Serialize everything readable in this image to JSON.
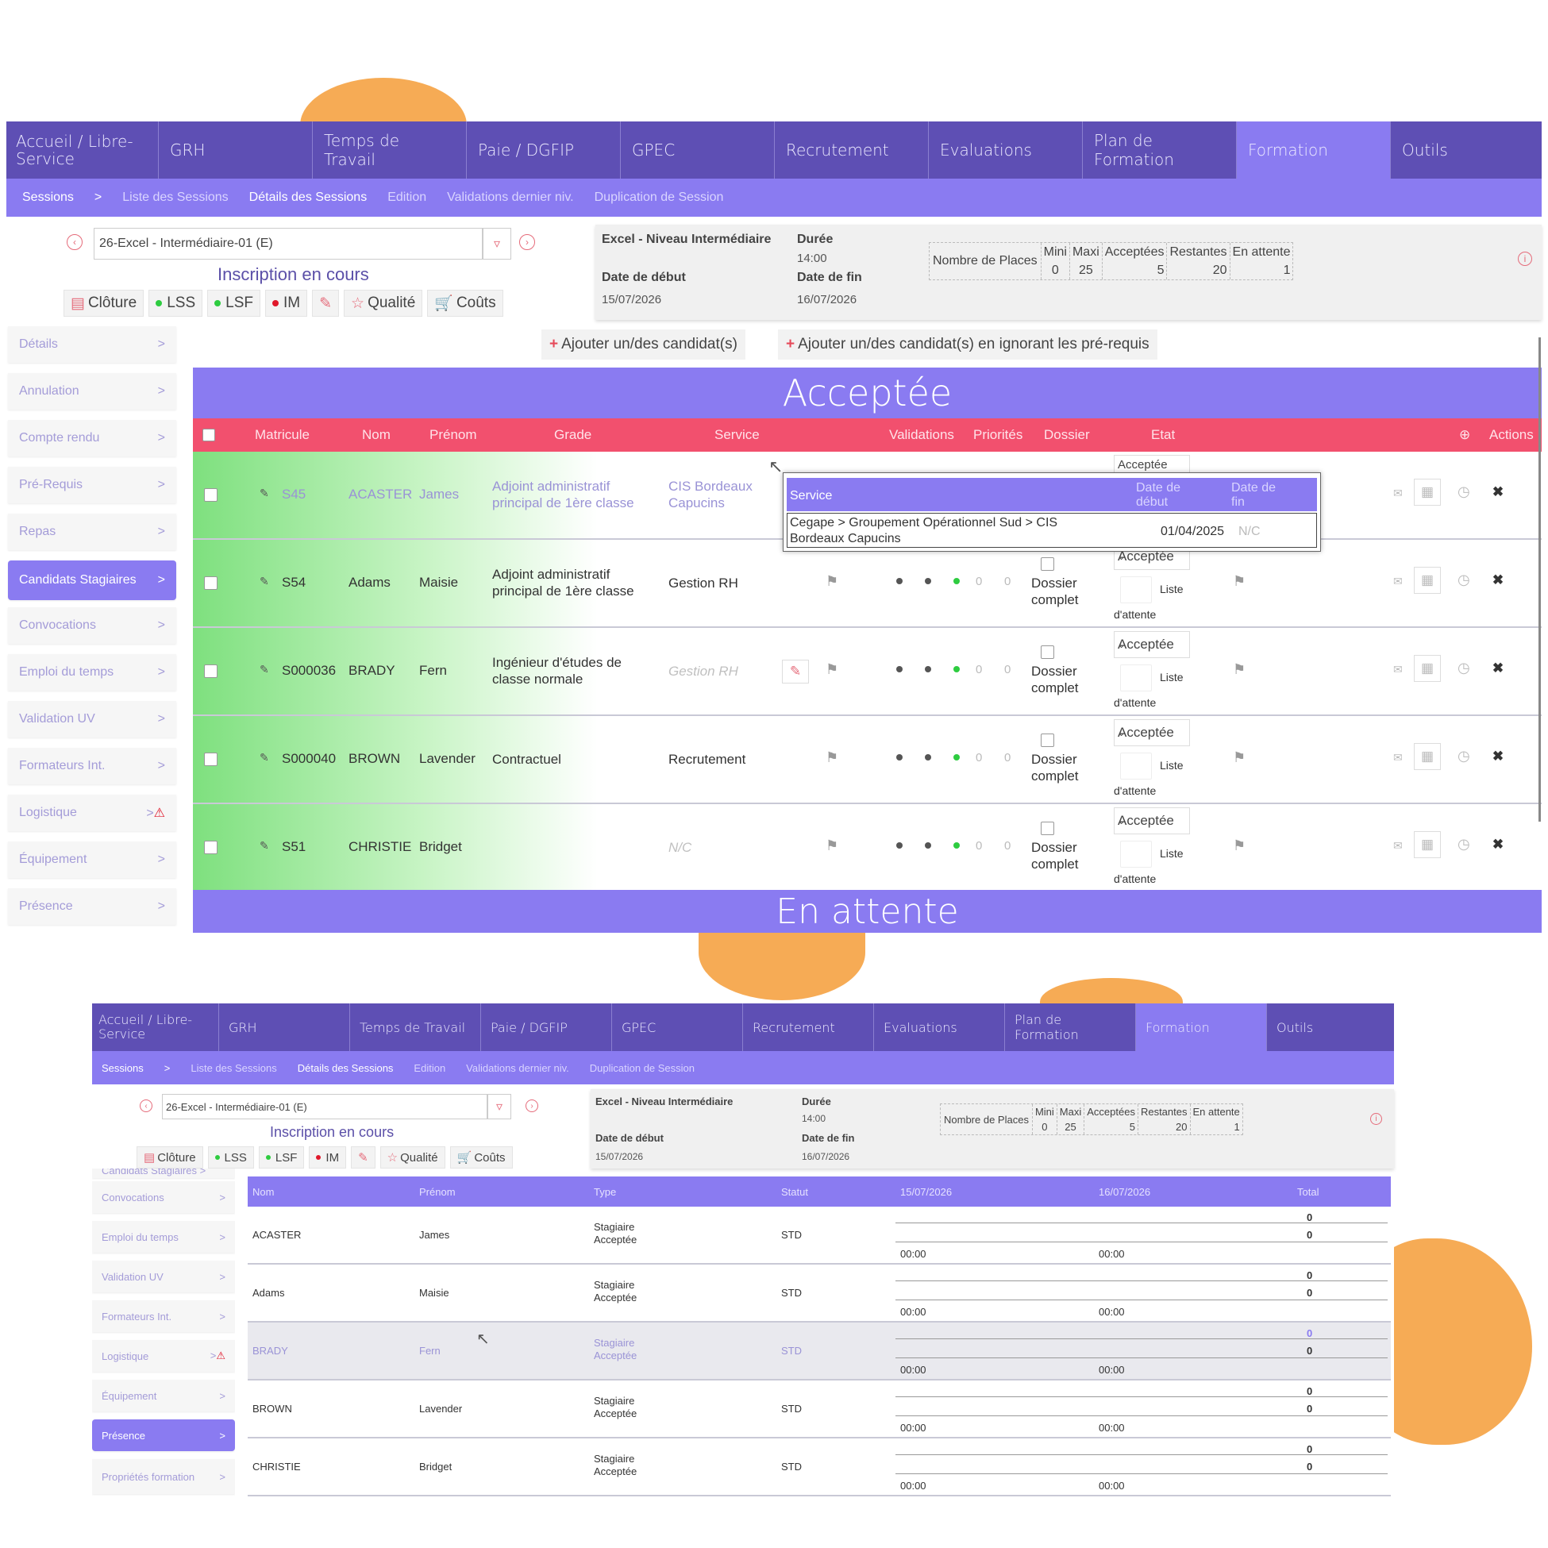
{
  "nav": {
    "tabs": [
      "Accueil / Libre-Service",
      "GRH",
      "Temps de Travail",
      "Paie / DGFIP",
      "GPEC",
      "Recrutement",
      "Evaluations",
      "Plan de Formation",
      "Formation",
      "Outils"
    ],
    "active": "Formation"
  },
  "subnav": {
    "items": [
      "Sessions",
      ">",
      "Liste des Sessions",
      "Détails des Sessions",
      "Edition",
      "Validations dernier niv.",
      "Duplication de Session"
    ],
    "current": "Détails des Sessions"
  },
  "session": {
    "select_value": "26-Excel - Intermédiaire-01 (E)",
    "status": "Inscription en cours",
    "buttons": {
      "cloture": "Clôture",
      "lss": "LSS",
      "lsf": "LSF",
      "im": "IM",
      "qualite": "Qualité",
      "couts": "Coûts"
    },
    "colors": {
      "lss": "#2ecc40",
      "lsf": "#2ecc40",
      "im": "#e0182b"
    }
  },
  "info": {
    "title": "Excel - Niveau Intermédiaire",
    "duree_label": "Durée",
    "duree": "14:00",
    "debut_label": "Date de début",
    "debut": "15/07/2026",
    "fin_label": "Date de fin",
    "fin": "16/07/2026",
    "places_label": "Nombre de Places",
    "places": [
      {
        "label": "Mini",
        "value": "0"
      },
      {
        "label": "Maxi",
        "value": "25"
      },
      {
        "label": "Acceptées",
        "value": "5"
      },
      {
        "label": "Restantes",
        "value": "20"
      },
      {
        "label": "En attente",
        "value": "1"
      }
    ]
  },
  "sidebar": {
    "items": [
      "Détails",
      "Annulation",
      "Compte rendu",
      "Pré-Requis",
      "Repas",
      "Candidats Stagiaires",
      "Convocations",
      "Emploi du temps",
      "Validation UV",
      "Formateurs Int.",
      "Logistique",
      "Équipement",
      "Présence"
    ],
    "active": "Candidats Stagiaires",
    "arrow": ">"
  },
  "actions": {
    "add": "Ajouter un/des candidat(s)",
    "add_ignore": "Ajouter un/des candidat(s) en ignorant les pré-requis"
  },
  "accepted": {
    "band": "Acceptée",
    "headers": [
      "Matricule",
      "Nom",
      "Prénom",
      "Grade",
      "Service",
      "Validations",
      "Priorités",
      "Dossier",
      "Etat",
      "Actions"
    ],
    "rows": [
      {
        "matricule": "S45",
        "nom": "ACASTER",
        "prenom": "James",
        "grade": "Adjoint administratif principal de 1ère classe",
        "service": "CIS Bordeaux Capucins",
        "etat": "Acceptée"
      },
      {
        "matricule": "S54",
        "nom": "Adams",
        "prenom": "Maisie",
        "grade": "Adjoint administratif principal de 1ère classe",
        "service": "Gestion RH",
        "etat": "Acceptée"
      },
      {
        "matricule": "S000036",
        "nom": "BRADY",
        "prenom": "Fern",
        "grade": "Ingénieur d'études de classe normale",
        "service": "Gestion RH",
        "etat": "Acceptée"
      },
      {
        "matricule": "S000040",
        "nom": "BROWN",
        "prenom": "Lavender",
        "grade": "Contractuel",
        "service": "Recrutement",
        "etat": "Acceptée"
      },
      {
        "matricule": "S51",
        "nom": "CHRISTIE",
        "prenom": "Bridget",
        "grade": "",
        "service": "N/C",
        "etat": "Acceptée"
      }
    ],
    "zero": "0",
    "dossier": "Dossier complet",
    "liste": "Liste",
    "attente": "d'attente"
  },
  "tooltip": {
    "headers": [
      "Service",
      "Date de début",
      "Date de fin"
    ],
    "service": "Cegape > Groupement Opérationnel Sud > CIS Bordeaux Capucins",
    "debut": "01/04/2025",
    "fin": "N/C"
  },
  "waiting_band": "En attente",
  "presence": {
    "sidebar_cut": "Candidats Stagiaires >",
    "sidebar": [
      "Convocations",
      "Emploi du temps",
      "Validation UV",
      "Formateurs Int.",
      "Logistique",
      "Équipement",
      "Présence",
      "Propriétés formation"
    ],
    "active": "Présence",
    "headers": [
      "Nom",
      "Prénom",
      "Type",
      "Statut",
      "15/07/2026",
      "16/07/2026",
      "Total"
    ],
    "rows": [
      {
        "nom": "ACASTER",
        "prenom": "James",
        "type": "Stagiaire Acceptée",
        "statut": "STD",
        "t1": "00:00",
        "t2": "00:00",
        "a": "0",
        "b": "0"
      },
      {
        "nom": "Adams",
        "prenom": "Maisie",
        "type": "Stagiaire Acceptée",
        "statut": "STD",
        "t1": "00:00",
        "t2": "00:00",
        "a": "0",
        "b": "0"
      },
      {
        "nom": "BRADY",
        "prenom": "Fern",
        "type": "Stagiaire Acceptée",
        "statut": "STD",
        "t1": "00:00",
        "t2": "00:00",
        "a": "0",
        "b": "0"
      },
      {
        "nom": "BROWN",
        "prenom": "Lavender",
        "type": "Stagiaire Acceptée",
        "statut": "STD",
        "t1": "00:00",
        "t2": "00:00",
        "a": "0",
        "b": "0"
      },
      {
        "nom": "CHRISTIE",
        "prenom": "Bridget",
        "type": "Stagiaire Acceptée",
        "statut": "STD",
        "t1": "00:00",
        "t2": "00:00",
        "a": "0",
        "b": "0"
      }
    ]
  },
  "colors": {
    "accent": "#8a7bf1",
    "nav": "#5e4fb4",
    "header": "#f2506e",
    "blob": "#f6ab55"
  }
}
